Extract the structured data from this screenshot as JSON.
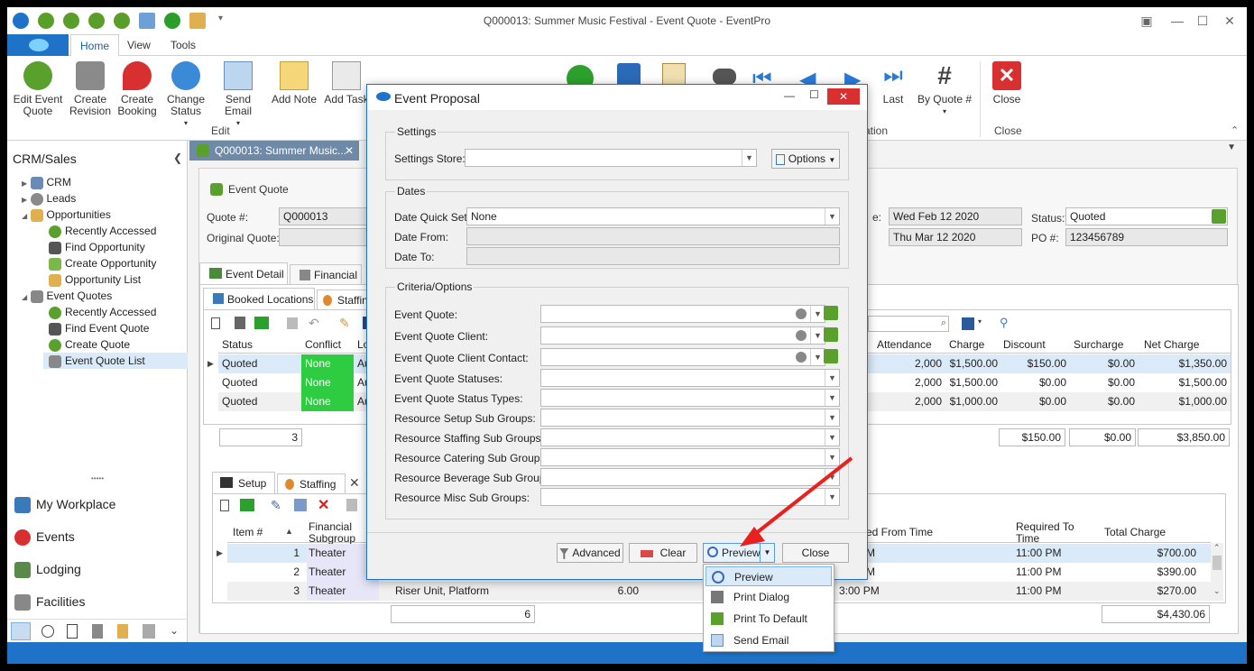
{
  "window": {
    "title": "Q000013: Summer Music Festival - Event Quote - EventPro"
  },
  "ribbon_tabs": [
    "Home",
    "View",
    "Tools"
  ],
  "ribbon": {
    "buttons": [
      {
        "label": "Edit Event",
        "label2": "Quote"
      },
      {
        "label": "Create",
        "label2": "Revision"
      },
      {
        "label": "Create",
        "label2": "Booking"
      },
      {
        "label": "Change",
        "label2": "Status"
      },
      {
        "label": "Send Email",
        "label2": ""
      },
      {
        "label": "Add Note",
        "label2": ""
      },
      {
        "label": "Add Task",
        "label2": ""
      },
      {
        "label": "Last",
        "label2": ""
      },
      {
        "label": "By Quote #",
        "label2": ""
      },
      {
        "label": "Close",
        "label2": ""
      }
    ],
    "groups": {
      "edit": "Edit",
      "navigation": "ation",
      "close": "Close"
    }
  },
  "sidebar": {
    "title": "CRM/Sales",
    "tree": [
      "CRM",
      "Leads",
      "Opportunities",
      "Recently Accessed",
      "Find Opportunity",
      "Create Opportunity",
      "Opportunity List",
      "Event Quotes",
      "Recently Accessed",
      "Find Event Quote",
      "Create Quote",
      "Event Quote List"
    ],
    "nav": [
      "My Workplace",
      "Events",
      "Lodging",
      "Facilities"
    ],
    "grip": "•••••"
  },
  "doc_tab": {
    "label": "Q000013: Summer Music...",
    "close": "✕"
  },
  "quote": {
    "section_label": "Event Quote",
    "quote_no_label": "Quote #:",
    "quote_no": "Q000013",
    "original_label": "Original Quote:",
    "date_label_partial": "e:",
    "date1": "Wed Feb 12 2020",
    "date2": "Thu Mar 12 2020",
    "status_label": "Status:*",
    "status": "Quoted",
    "po_label": "PO #:",
    "po": "123456789"
  },
  "tabs": {
    "event_detail": "Event Detail",
    "financial": "Financial",
    "booked_locations": "Booked Locations",
    "staffing_partial": "Staffin"
  },
  "locations": {
    "headers_left": [
      "Status",
      "Conflict",
      "Lo"
    ],
    "headers_right": [
      "Attendance",
      "Charge",
      "Discount",
      "Surcharge",
      "Net Charge"
    ],
    "rows": [
      {
        "status": "Quoted",
        "conflict": "None",
        "loc": "Au",
        "attendance": "2,000",
        "charge": "$1,500.00",
        "discount": "$150.00",
        "surcharge": "$0.00",
        "net": "$1,350.00"
      },
      {
        "status": "Quoted",
        "conflict": "None",
        "loc": "Au",
        "attendance": "2,000",
        "charge": "$1,500.00",
        "discount": "$0.00",
        "surcharge": "$0.00",
        "net": "$1,500.00"
      },
      {
        "status": "Quoted",
        "conflict": "None",
        "loc": "Au",
        "attendance": "2,000",
        "charge": "$1,000.00",
        "discount": "$0.00",
        "surcharge": "$0.00",
        "net": "$1,000.00"
      }
    ],
    "count": "3",
    "total_discount": "$150.00",
    "total_surcharge": "$0.00",
    "total_net": "$3,850.00"
  },
  "bottom_tabs": {
    "setup": "Setup",
    "staffing": "Staffing"
  },
  "setup": {
    "headers": {
      "item": "Item #",
      "subgroup1": "Financial",
      "subgroup2": "Subgroup",
      "from_time": "ed From Time",
      "req1": "Required To",
      "req2": "Time",
      "total": "Total Charge"
    },
    "rows": [
      {
        "num": "1",
        "subgroup": "Theater",
        "name": "",
        "qty": "",
        "from": "M",
        "req": "11:00 PM",
        "total": "$700.00"
      },
      {
        "num": "2",
        "subgroup": "Theater",
        "name": "",
        "qty": "",
        "from": "M",
        "req": "11:00 PM",
        "total": "$390.00"
      },
      {
        "num": "3",
        "subgroup": "Theater",
        "name": "Riser Unit, Platform",
        "qty": "6.00",
        "from": "3:00 PM",
        "req": "11:00 PM",
        "total": "$270.00"
      }
    ],
    "count": "6",
    "total": "$4,430.06"
  },
  "dialog": {
    "title": "Event Proposal",
    "settings_group": "Settings",
    "settings_store_label": "Settings Store:",
    "settings_store_value": "",
    "options_button": "Options",
    "dates_group": "Dates",
    "date_quick_label": "Date Quick Set:",
    "date_quick_value": "None",
    "date_from_label": "Date From:",
    "date_to_label": "Date To:",
    "criteria_group": "Criteria/Options",
    "criteria": [
      "Event Quote:",
      "Event Quote Client:",
      "Event Quote Client Contact:",
      "Event Quote Statuses:",
      "Event Quote Status Types:",
      "Resource Setup Sub Groups:",
      "Resource Staffing Sub Groups:",
      "Resource Catering Sub Groups:",
      "Resource Beverage Sub Groups:",
      "Resource Misc Sub Groups:"
    ],
    "advanced_button": "Advanced",
    "clear_button": "Clear",
    "preview_button": "Preview",
    "close_button": "Close"
  },
  "preview_menu": [
    "Preview",
    "Print Dialog",
    "Print To Default",
    "Send Email"
  ],
  "colors": {
    "accent": "#1e72c8",
    "conflict_none": "#2ecc40",
    "arrow": "#e8201e",
    "row_highlight": "#dbeaf8"
  }
}
